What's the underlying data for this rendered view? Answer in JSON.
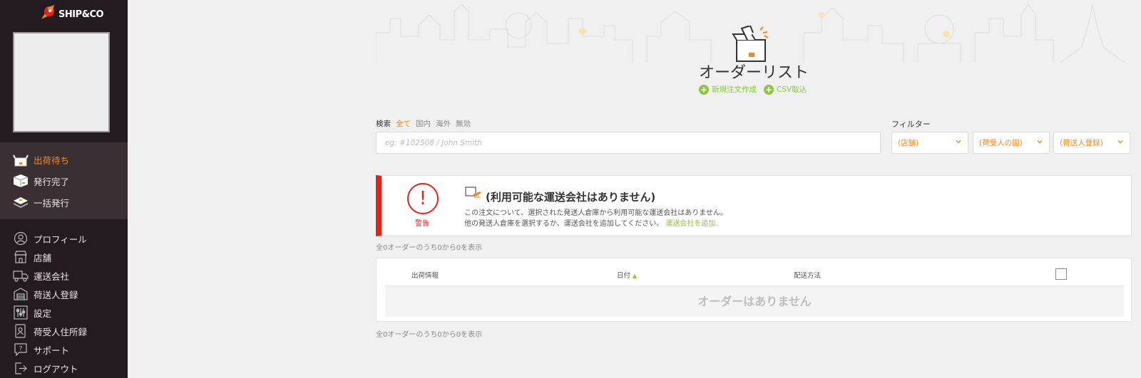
{
  "logo": {
    "text": "SHIP&CO"
  },
  "sidebar": {
    "primary": [
      {
        "label": "出荷待ち",
        "icon": "box-open-icon",
        "active": true
      },
      {
        "label": "発行完了",
        "icon": "box-closed-icon",
        "active": false
      },
      {
        "label": "一括発行",
        "icon": "stack-icon",
        "active": false
      }
    ],
    "secondary": [
      {
        "label": "プロフィール",
        "icon": "user-icon"
      },
      {
        "label": "店舗",
        "icon": "store-icon"
      },
      {
        "label": "運送会社",
        "icon": "truck-icon"
      },
      {
        "label": "荷送人登録",
        "icon": "warehouse-icon"
      },
      {
        "label": "設定",
        "icon": "sliders-icon"
      },
      {
        "label": "荷受人住所録",
        "icon": "address-book-icon"
      },
      {
        "label": "サポート",
        "icon": "help-icon"
      },
      {
        "label": "ログアウト",
        "icon": "logout-icon"
      }
    ]
  },
  "page": {
    "title": "オーダーリスト",
    "new_order": "新規注文作成",
    "csv_import": "CSV取込"
  },
  "search": {
    "label": "検索",
    "scopes": [
      "全て",
      "国内",
      "海外",
      "無効"
    ],
    "selected_scope": "全て",
    "placeholder": "eg: #102508 / John Smith"
  },
  "filter": {
    "label": "フィルター",
    "selects": [
      "(店舗)",
      "(荷受人の国)",
      "(荷送人登録)"
    ]
  },
  "alert": {
    "badge": "警告",
    "title": "(利用可能な運送会社はありません)",
    "line1": "この注文について、選択された発送人倉庫から利用可能な運送会社はありません。",
    "line2": "他の発送人倉庫を選択するか、運送会社を追加してください。",
    "link": "運送会社を追加."
  },
  "count_text": "全0オーダーのうち0から0を表示",
  "table": {
    "col_shipping": "出荷情報",
    "col_date": "日付",
    "col_method": "配送方法",
    "empty": "オーダーはありません"
  },
  "colors": {
    "accent": "#f08a24",
    "green": "#8cc63e",
    "danger": "#e2231a",
    "sidebar": "#241b20"
  }
}
